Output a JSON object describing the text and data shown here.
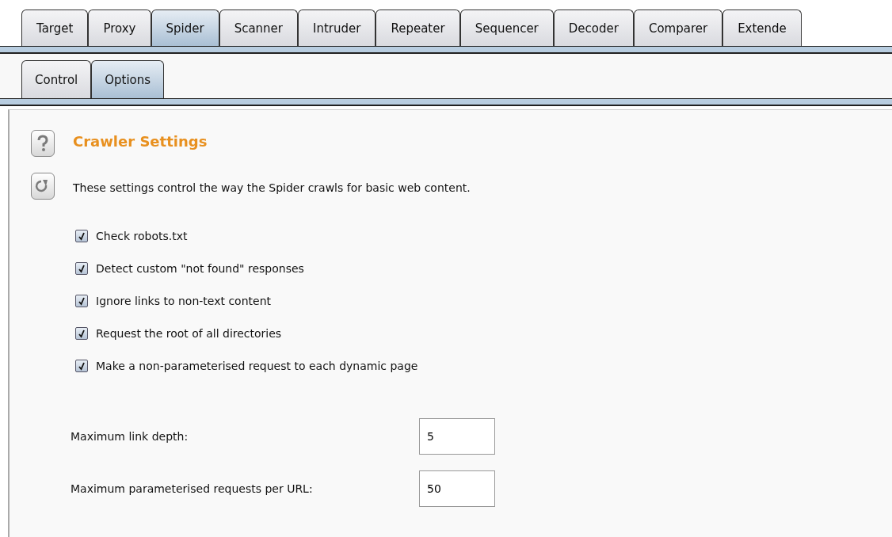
{
  "tabs": [
    {
      "label": "Target",
      "selected": false
    },
    {
      "label": "Proxy",
      "selected": false
    },
    {
      "label": "Spider",
      "selected": true
    },
    {
      "label": "Scanner",
      "selected": false
    },
    {
      "label": "Intruder",
      "selected": false
    },
    {
      "label": "Repeater",
      "selected": false
    },
    {
      "label": "Sequencer",
      "selected": false
    },
    {
      "label": "Decoder",
      "selected": false
    },
    {
      "label": "Comparer",
      "selected": false
    },
    {
      "label": "Extende",
      "selected": false
    }
  ],
  "subtabs": [
    {
      "label": "Control",
      "selected": false
    },
    {
      "label": "Options",
      "selected": true
    }
  ],
  "section": {
    "title": "Crawler Settings",
    "description": "These settings control the way the Spider crawls for basic web content.",
    "options": [
      {
        "label": "Check robots.txt",
        "checked": true
      },
      {
        "label": "Detect custom \"not found\" responses",
        "checked": true
      },
      {
        "label": "Ignore links to non-text content",
        "checked": true
      },
      {
        "label": "Request the root of all directories",
        "checked": true
      },
      {
        "label": "Make a non-parameterised request to each dynamic page",
        "checked": true
      }
    ],
    "fields": [
      {
        "label": "Maximum link depth:",
        "value": "5"
      },
      {
        "label": "Maximum parameterised requests per URL:",
        "value": "50"
      }
    ]
  }
}
